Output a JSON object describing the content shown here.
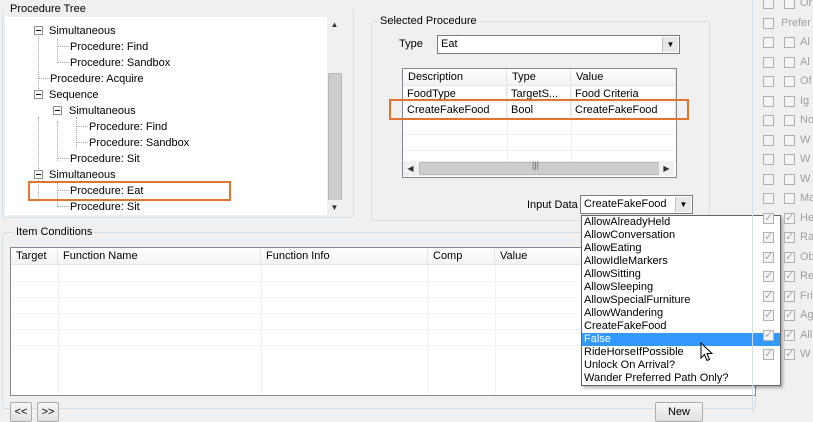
{
  "procedure_tree": {
    "title": "Procedure Tree",
    "nodes": [
      {
        "label": "Simultaneous"
      },
      {
        "label": "Procedure: Find"
      },
      {
        "label": "Procedure: Sandbox"
      },
      {
        "label": "Procedure: Acquire"
      },
      {
        "label": "Sequence"
      },
      {
        "label": "Simultaneous"
      },
      {
        "label": "Procedure: Find"
      },
      {
        "label": "Procedure: Sandbox"
      },
      {
        "label": "Procedure: Sit"
      },
      {
        "label": "Simultaneous"
      },
      {
        "label": "Procedure: Eat"
      },
      {
        "label": "Procedure: Sit"
      }
    ]
  },
  "selected_procedure": {
    "title": "Selected Procedure",
    "type_label": "Type",
    "type_value": "Eat",
    "columns": [
      "Description",
      "Type",
      "Value"
    ],
    "rows": [
      [
        "FoodType",
        "TargetS...",
        "Food Criteria"
      ],
      [
        "CreateFakeFood",
        "Bool",
        "CreateFakeFood"
      ]
    ],
    "input_data_label": "Input Data",
    "input_data_value": "CreateFakeFood"
  },
  "input_data_options": [
    "AllowAlreadyHeld",
    "AllowConversation",
    "AllowEating",
    "AllowIdleMarkers",
    "AllowSitting",
    "AllowSleeping",
    "AllowSpecialFurniture",
    "AllowWandering",
    "CreateFakeFood",
    "False",
    "RideHorseIfPossible",
    "Unlock On Arrival?",
    "Wander Preferred Path Only?"
  ],
  "item_conditions": {
    "title": "Item Conditions",
    "columns": [
      "Target",
      "Function Name",
      "Function Info",
      "Comp",
      "Value"
    ]
  },
  "bottom": {
    "prev_label": "<<",
    "next_label": ">>",
    "new_label": "New"
  },
  "right_panel": {
    "flags": [
      {
        "label": "Or",
        "checked": false
      },
      {
        "label": "Prefer",
        "checked": false
      },
      {
        "label": "Al",
        "checked": false
      },
      {
        "label": "Al",
        "checked": false
      },
      {
        "label": "Of",
        "checked": false
      },
      {
        "label": "Ig",
        "checked": false
      },
      {
        "label": "No",
        "checked": false
      },
      {
        "label": "W",
        "checked": false
      },
      {
        "label": "W",
        "checked": false
      },
      {
        "label": "W",
        "checked": false
      },
      {
        "label": "Ma",
        "checked": false
      },
      {
        "label": "He",
        "checked": true
      },
      {
        "label": "Ra",
        "checked": true
      },
      {
        "label": "Ob",
        "checked": true
      },
      {
        "label": "Re",
        "checked": true
      },
      {
        "label": "Fri",
        "checked": true
      },
      {
        "label": "Ag",
        "checked": true
      },
      {
        "label": "All",
        "checked": true
      },
      {
        "label": "W",
        "checked": true
      }
    ]
  }
}
